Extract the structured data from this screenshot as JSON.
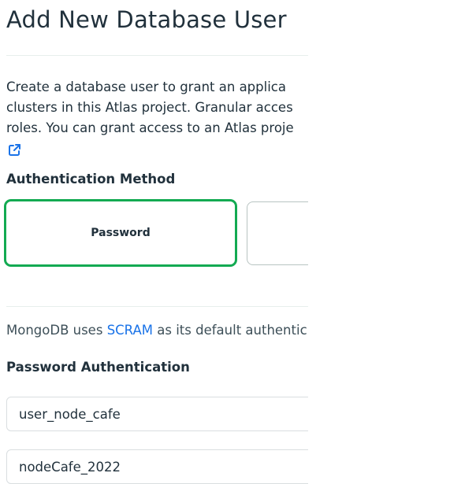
{
  "page": {
    "title": "Add New Database User",
    "intro_lines": [
      "Create a database user to grant an applica",
      "clusters in this Atlas project. Granular acces",
      "roles. You can grant access to an Atlas proje"
    ],
    "external_link_icon": "external-link-icon"
  },
  "auth_method": {
    "label": "Authentication Method",
    "options": [
      {
        "label": "Password",
        "selected": true
      },
      {
        "label": "",
        "selected": false
      }
    ],
    "selected_color": "#13aa52"
  },
  "info": {
    "prefix": "MongoDB uses ",
    "link_text": "SCRAM",
    "suffix": " as its default authentic",
    "link_color": "#1a73e8"
  },
  "password_auth": {
    "label": "Password Authentication",
    "username_value": "user_node_cafe",
    "password_value": "nodeCafe_2022"
  }
}
